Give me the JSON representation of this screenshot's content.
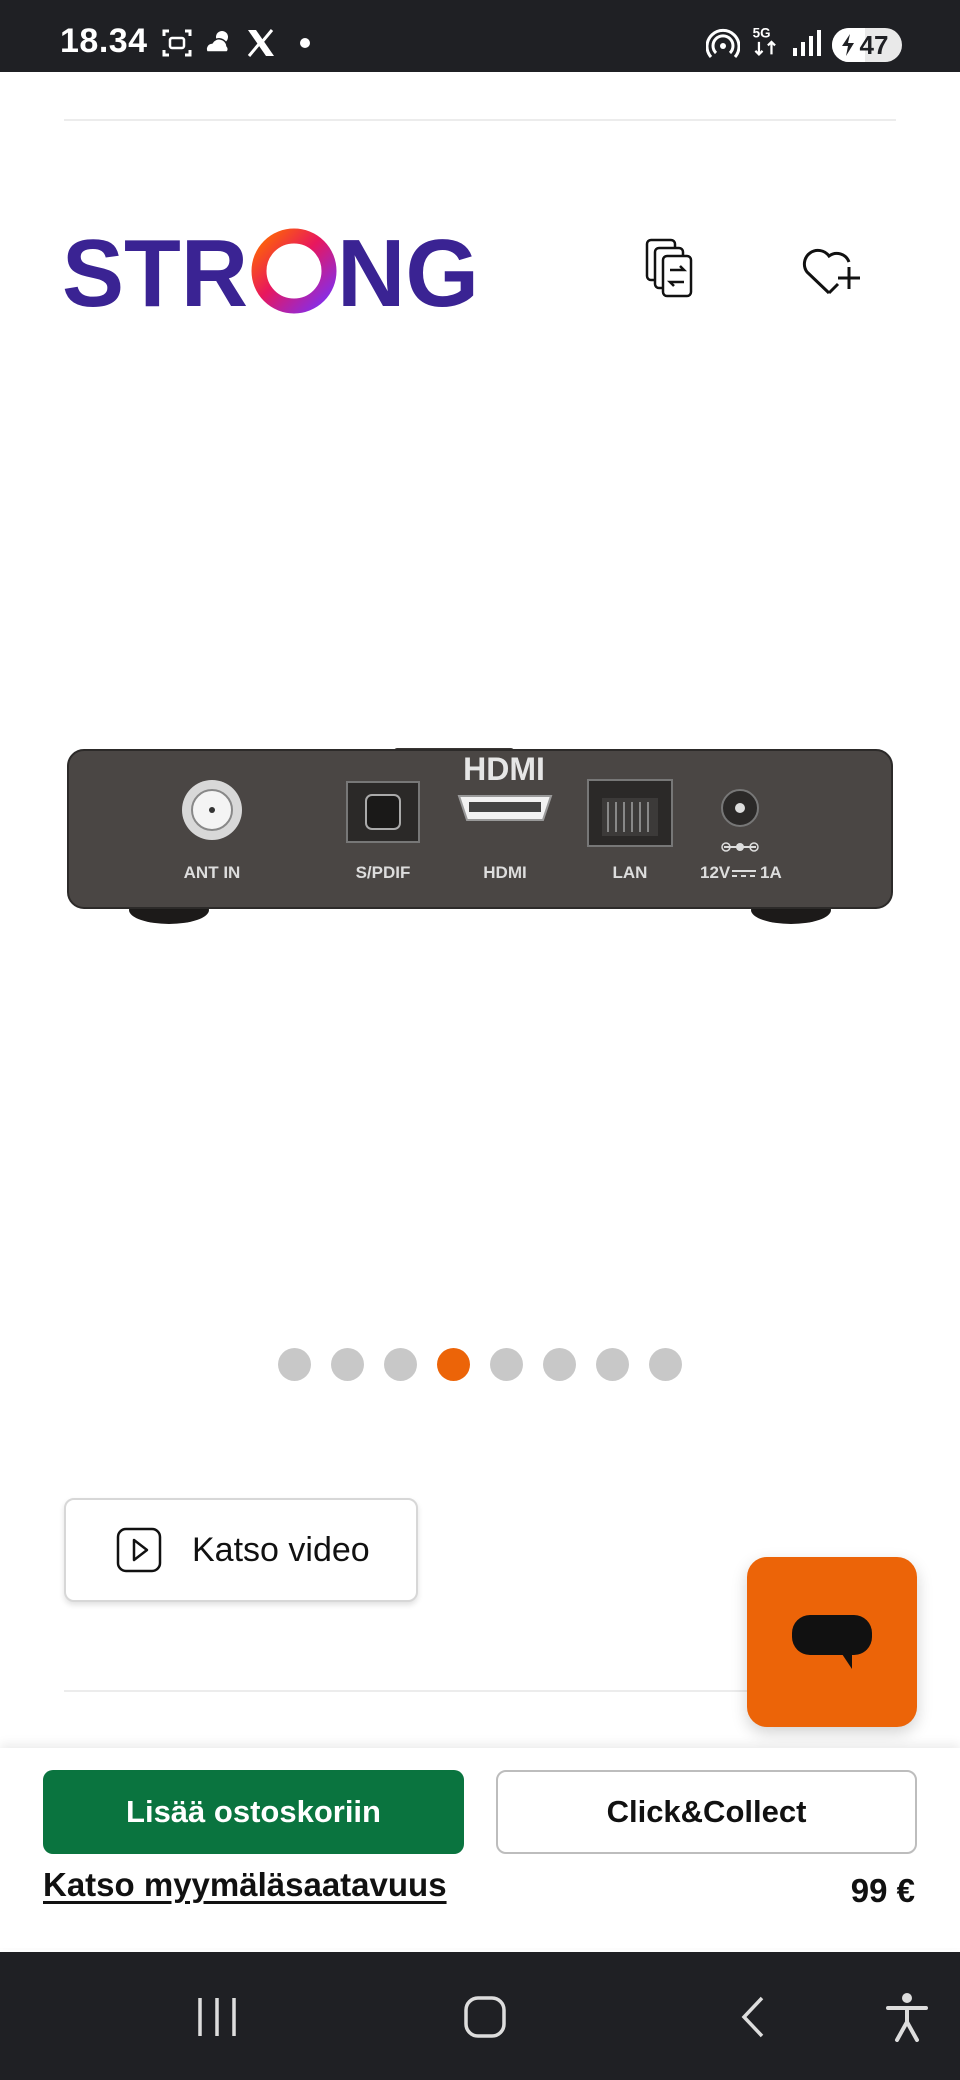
{
  "status_bar": {
    "time": "18.34",
    "battery": "47",
    "battery_level": 0.47,
    "icons": [
      "screenshot-icon",
      "weather-icon",
      "x-app-icon",
      "notification-dot-icon",
      "hotspot-icon",
      "5g-icon",
      "signal-icon",
      "battery-icon"
    ]
  },
  "header": {
    "logo_text": "STRONG",
    "compare_icon": "compare-icon",
    "wishlist_icon": "heart-plus-icon"
  },
  "product": {
    "image_labels": {
      "ant_in": "ANT IN",
      "spdif": "S/PDIF",
      "hdmi_logo": "HDMI",
      "hdmi": "HDMI",
      "lan": "LAN",
      "power": "12V",
      "power_amp": "1A"
    }
  },
  "carousel": {
    "dot_count": 8,
    "active_index": 3
  },
  "video": {
    "label": "Katso video"
  },
  "actions": {
    "add_to_cart": "Lisää ostoskoriin",
    "click_collect": "Click&Collect",
    "store_availability": "Katso myymäläsaatavuus",
    "price": "99 €"
  },
  "colors": {
    "accent": "#ec6408",
    "cart_green": "#0a743f",
    "status_bg": "#1f2024"
  },
  "nav": {
    "icons": [
      "recent-apps-icon",
      "home-icon",
      "back-icon",
      "accessibility-icon"
    ]
  }
}
